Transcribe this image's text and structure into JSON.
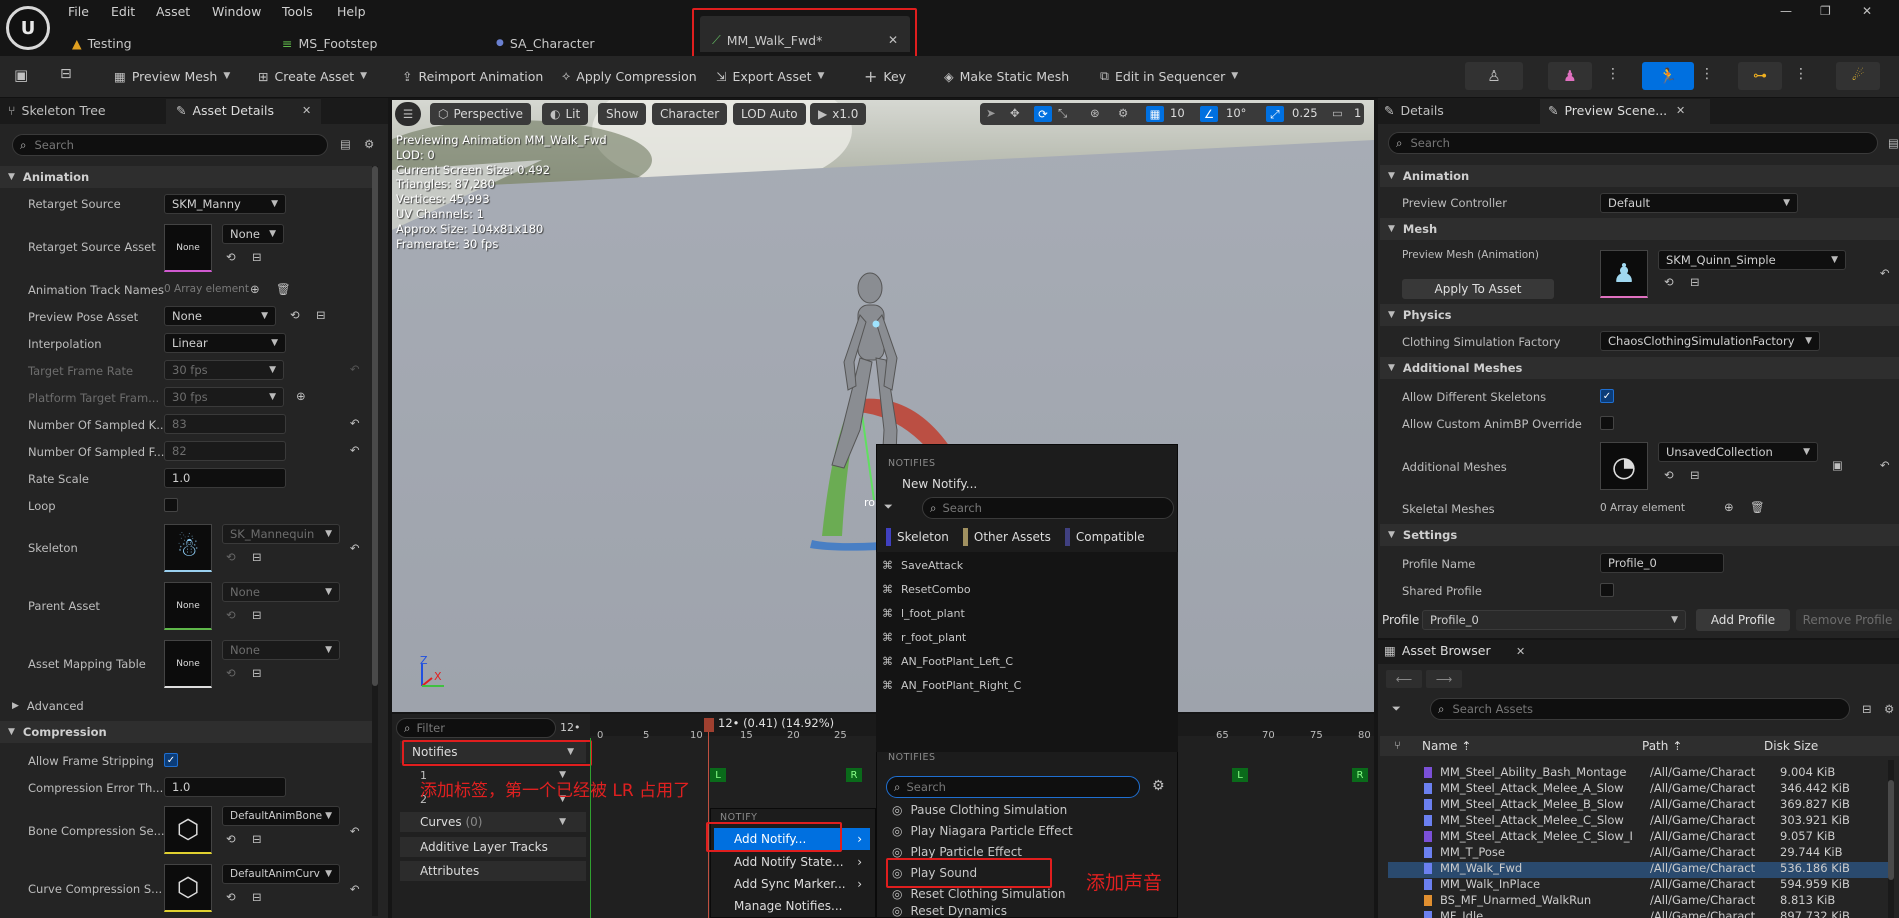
{
  "menu": [
    "File",
    "Edit",
    "Asset",
    "Window",
    "Tools",
    "Help"
  ],
  "doc_tabs": [
    {
      "label": "Testing"
    },
    {
      "label": "MS_Footstep"
    },
    {
      "label": "SA_Character"
    },
    {
      "label": "MM_Walk_Fwd*"
    }
  ],
  "window_controls": {
    "minimize": "—",
    "restore": "❐",
    "close": "✕"
  },
  "toolbar": {
    "preview_mesh": "Preview Mesh",
    "create_asset": "Create Asset",
    "reimport": "Reimport Animation",
    "apply_compression": "Apply Compression",
    "export_asset": "Export Asset",
    "key": "Key",
    "make_static_mesh": "Make Static Mesh",
    "edit_in_sequencer": "Edit in Sequencer"
  },
  "left_panel": {
    "tab_skeleton_tree": "Skeleton Tree",
    "tab_asset_details": "Asset Details",
    "search_placeholder": "Search",
    "sections": {
      "animation": "Animation",
      "advanced": "Advanced",
      "compression": "Compression"
    },
    "rows": {
      "retarget_source": {
        "label": "Retarget Source",
        "value": "SKM_Manny"
      },
      "retarget_source_asset": {
        "label": "Retarget Source Asset",
        "value": "None",
        "thumb": "None"
      },
      "animation_track_names": {
        "label": "Animation Track Names",
        "value": "0 Array element"
      },
      "preview_pose_asset": {
        "label": "Preview Pose Asset",
        "value": "None"
      },
      "interpolation": {
        "label": "Interpolation",
        "value": "Linear"
      },
      "target_frame_rate": {
        "label": "Target Frame Rate",
        "value": "30 fps"
      },
      "platform_target": {
        "label": "Platform Target Fram...",
        "value": "30 fps"
      },
      "num_sampled_keys": {
        "label": "Number Of Sampled K...",
        "value": "83"
      },
      "num_sampled_frames": {
        "label": "Number Of Sampled F...",
        "value": "82"
      },
      "rate_scale": {
        "label": "Rate Scale",
        "value": "1.0"
      },
      "loop": {
        "label": "Loop"
      },
      "skeleton": {
        "label": "Skeleton",
        "value": "SK_Mannequin"
      },
      "parent_asset": {
        "label": "Parent Asset",
        "value": "None",
        "thumb": "None"
      },
      "asset_mapping_table": {
        "label": "Asset Mapping Table",
        "value": "None",
        "thumb": "None"
      },
      "allow_frame_stripping": {
        "label": "Allow Frame Stripping"
      },
      "compression_error": {
        "label": "Compression Error Th...",
        "value": "1.0"
      },
      "bone_compression": {
        "label": "Bone Compression Se...",
        "value": "DefaultAnimBone"
      },
      "curve_compression": {
        "label": "Curve Compression S...",
        "value": "DefaultAnimCurv"
      }
    }
  },
  "viewport": {
    "perspective": "Perspective",
    "lit": "Lit",
    "show": "Show",
    "character": "Character",
    "lod": "LOD Auto",
    "speed": "x1.0",
    "grid_size": "10",
    "angle": "10°",
    "scale": "0.25",
    "camera_speed": "1",
    "info_lines": [
      "Previewing Animation MM_Walk_Fwd",
      "LOD: 0",
      "Current Screen Size: 0.492",
      "Triangles: 87,280",
      "Vertices: 45,993",
      "UV Channels: 1",
      "Approx Size: 104x81x180",
      "Framerate: 30 fps"
    ],
    "axis_z": "Z",
    "axis_x": "X",
    "root_label": "ro"
  },
  "timeline": {
    "filter_placeholder": "Filter",
    "frame_count": "12•",
    "current_frame": "12• (0.41) (14.92%)",
    "ticks_left": [
      "0",
      "5",
      "10",
      "15",
      "20",
      "25"
    ],
    "ticks_right": [
      "65",
      "70",
      "75",
      "80"
    ],
    "tracks": {
      "notifies": "Notifies",
      "track1": "1",
      "track2": "2",
      "curves": "Curves",
      "curves_count": "(0)",
      "additive": "Additive Layer Tracks",
      "attributes": "Attributes"
    },
    "annotation_tracks": "添加标签，第一个已经被 LR 占用了",
    "annotation_sound": "添加声音",
    "markers": {
      "L": "L",
      "R": "R"
    }
  },
  "context_menu": {
    "header": "NOTIFY",
    "items": [
      "Add Notify...",
      "Add Notify State...",
      "Add Sync Marker...",
      "Manage Notifies..."
    ]
  },
  "notify_picker": {
    "header1": "NOTIFIES",
    "new_notify": "New Notify...",
    "search_placeholder": "Search",
    "filters": [
      "Skeleton",
      "Other Assets",
      "Compatible"
    ],
    "skeleton_notifies": [
      "SaveAttack",
      "ResetCombo",
      "l_foot_plant",
      "r_foot_plant",
      "AN_FootPlant_Left_C",
      "AN_FootPlant_Right_C"
    ],
    "header2": "NOTIFIES",
    "search2_placeholder": "Search",
    "class_notifies": [
      "Pause Clothing Simulation",
      "Play Niagara Particle Effect",
      "Play Particle Effect",
      "Play Sound",
      "Reset Clothing Simulation",
      "Reset Dynamics"
    ]
  },
  "right_panel": {
    "tab_details": "Details",
    "tab_preview": "Preview Scene...",
    "search_placeholder": "Search",
    "sections": {
      "animation": "Animation",
      "mesh": "Mesh",
      "physics": "Physics",
      "additional": "Additional Meshes",
      "settings": "Settings"
    },
    "preview_controller": {
      "label": "Preview Controller",
      "value": "Default"
    },
    "preview_mesh": {
      "label": "Preview Mesh (Animation)",
      "value": "SKM_Quinn_Simple"
    },
    "apply_to_asset": "Apply To Asset",
    "clothing_factory": {
      "label": "Clothing Simulation Factory",
      "value": "ChaosClothingSimulationFactory"
    },
    "allow_diff_skeletons": {
      "label": "Allow Different Skeletons"
    },
    "allow_custom_animbp": {
      "label": "Allow Custom AnimBP Override"
    },
    "additional_meshes": {
      "label": "Additional Meshes",
      "value": "UnsavedCollection"
    },
    "skeletal_meshes": {
      "label": "Skeletal Meshes",
      "value": "0 Array element"
    },
    "profile_name": {
      "label": "Profile Name",
      "value": "Profile_0"
    },
    "shared_profile": {
      "label": "Shared Profile"
    },
    "profile": {
      "label": "Profile",
      "value": "Profile_0"
    },
    "add_profile": "Add Profile",
    "remove_profile": "Remove Profile"
  },
  "asset_browser": {
    "title": "Asset Browser",
    "search_placeholder": "Search Assets",
    "columns": {
      "name": "Name",
      "path": "Path",
      "size": "Disk Size"
    },
    "rows": [
      {
        "name": "MM_Steel_Ability_Bash_Montage",
        "path": "/All/Game/Charact",
        "size": "9.004 KiB",
        "kind": "montage"
      },
      {
        "name": "MM_Steel_Attack_Melee_A_Slow",
        "path": "/All/Game/Charact",
        "size": "346.442 KiB",
        "kind": "anim"
      },
      {
        "name": "MM_Steel_Attack_Melee_B_Slow",
        "path": "/All/Game/Charact",
        "size": "369.827 KiB",
        "kind": "anim"
      },
      {
        "name": "MM_Steel_Attack_Melee_C_Slow",
        "path": "/All/Game/Charact",
        "size": "303.921 KiB",
        "kind": "anim"
      },
      {
        "name": "MM_Steel_Attack_Melee_C_Slow_I",
        "path": "/All/Game/Charact",
        "size": "9.057 KiB",
        "kind": "montage"
      },
      {
        "name": "MM_T_Pose",
        "path": "/All/Game/Charact",
        "size": "29.744 KiB",
        "kind": "anim"
      },
      {
        "name": "MM_Walk_Fwd",
        "path": "/All/Game/Charact",
        "size": "536.186 KiB",
        "kind": "anim"
      },
      {
        "name": "MM_Walk_InPlace",
        "path": "/All/Game/Charact",
        "size": "594.959 KiB",
        "kind": "anim"
      },
      {
        "name": "BS_MF_Unarmed_WalkRun",
        "path": "/All/Game/Charact",
        "size": "8.813 KiB",
        "kind": "blend"
      },
      {
        "name": "MF_Idle",
        "path": "/All/Game/Charact",
        "size": "897.732 KiB",
        "kind": "anim"
      }
    ]
  },
  "colors": {
    "accent_blue": "#1565c0",
    "highlight": "#0070e0",
    "red_annotation": "#e01e1e",
    "selected_row": "#2a4a6e"
  }
}
